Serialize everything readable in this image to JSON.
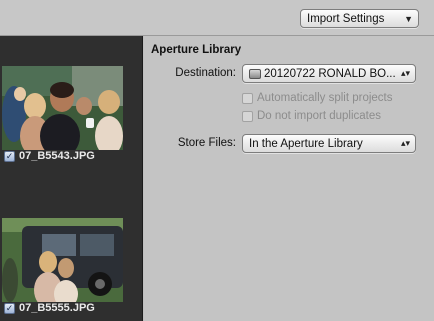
{
  "toolbar": {
    "import_settings_label": "Import Settings",
    "import_settings_arrow": "▼"
  },
  "browser": {
    "items": [
      {
        "filename": "07_B5543.JPG",
        "checked": true
      },
      {
        "filename": "07_B5555.JPG",
        "checked": true
      }
    ]
  },
  "panel": {
    "title": "Aperture Library",
    "destination": {
      "label": "Destination:",
      "value": "20120722 RONALD BO...",
      "icon": "drive-icon"
    },
    "auto_split": {
      "label": "Automatically split projects",
      "enabled": false
    },
    "no_duplicates": {
      "label": "Do not import duplicates",
      "enabled": false
    },
    "store_files": {
      "label": "Store Files:",
      "value": "In the Aperture Library"
    },
    "popup_arrows": "▴▾"
  },
  "colors": {
    "panel_bg": "#c4c4c4",
    "browser_bg": "#2f2f2f",
    "disabled_text": "#8c8c8c"
  }
}
